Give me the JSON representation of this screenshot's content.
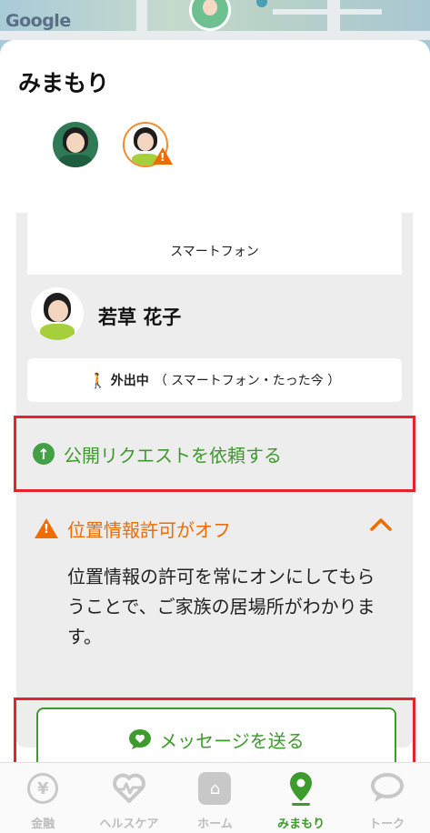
{
  "map": {
    "provider_logo": "Google"
  },
  "sheet": {
    "title": "みまもり",
    "avatars": [
      {
        "icon": "family-avatar-icon"
      },
      {
        "icon": "family-avatar-warning-icon"
      }
    ],
    "device_label": "スマートフォン"
  },
  "member": {
    "name": "若草 花子",
    "status_icon": "walking-person-icon",
    "status_main": "外出中",
    "status_detail": "（ スマートフォン・たった今 ）",
    "request_label": "公開リクエストを依頼する",
    "warning": {
      "title": "位置情報許可がオフ",
      "description": "位置情報の許可を常にオンにしてもらうことで、ご家族の居場所がわかります。"
    },
    "message_button": "メッセージを送る"
  },
  "tabs": [
    {
      "label": "金融",
      "icon": "yen-coin-icon",
      "glyph": "¥",
      "active": false
    },
    {
      "label": "ヘルスケア",
      "icon": "heart-pulse-icon",
      "active": false
    },
    {
      "label": "ホーム",
      "icon": "home-icon",
      "active": false
    },
    {
      "label": "みまもり",
      "icon": "location-pin-icon",
      "active": true
    },
    {
      "label": "トーク",
      "icon": "chat-bubble-icon",
      "active": false
    }
  ],
  "colors": {
    "accent_green": "#3d9a2c",
    "warning_orange": "#ef6c00",
    "highlight_red": "#e5232b",
    "card_gray": "#ededed"
  }
}
